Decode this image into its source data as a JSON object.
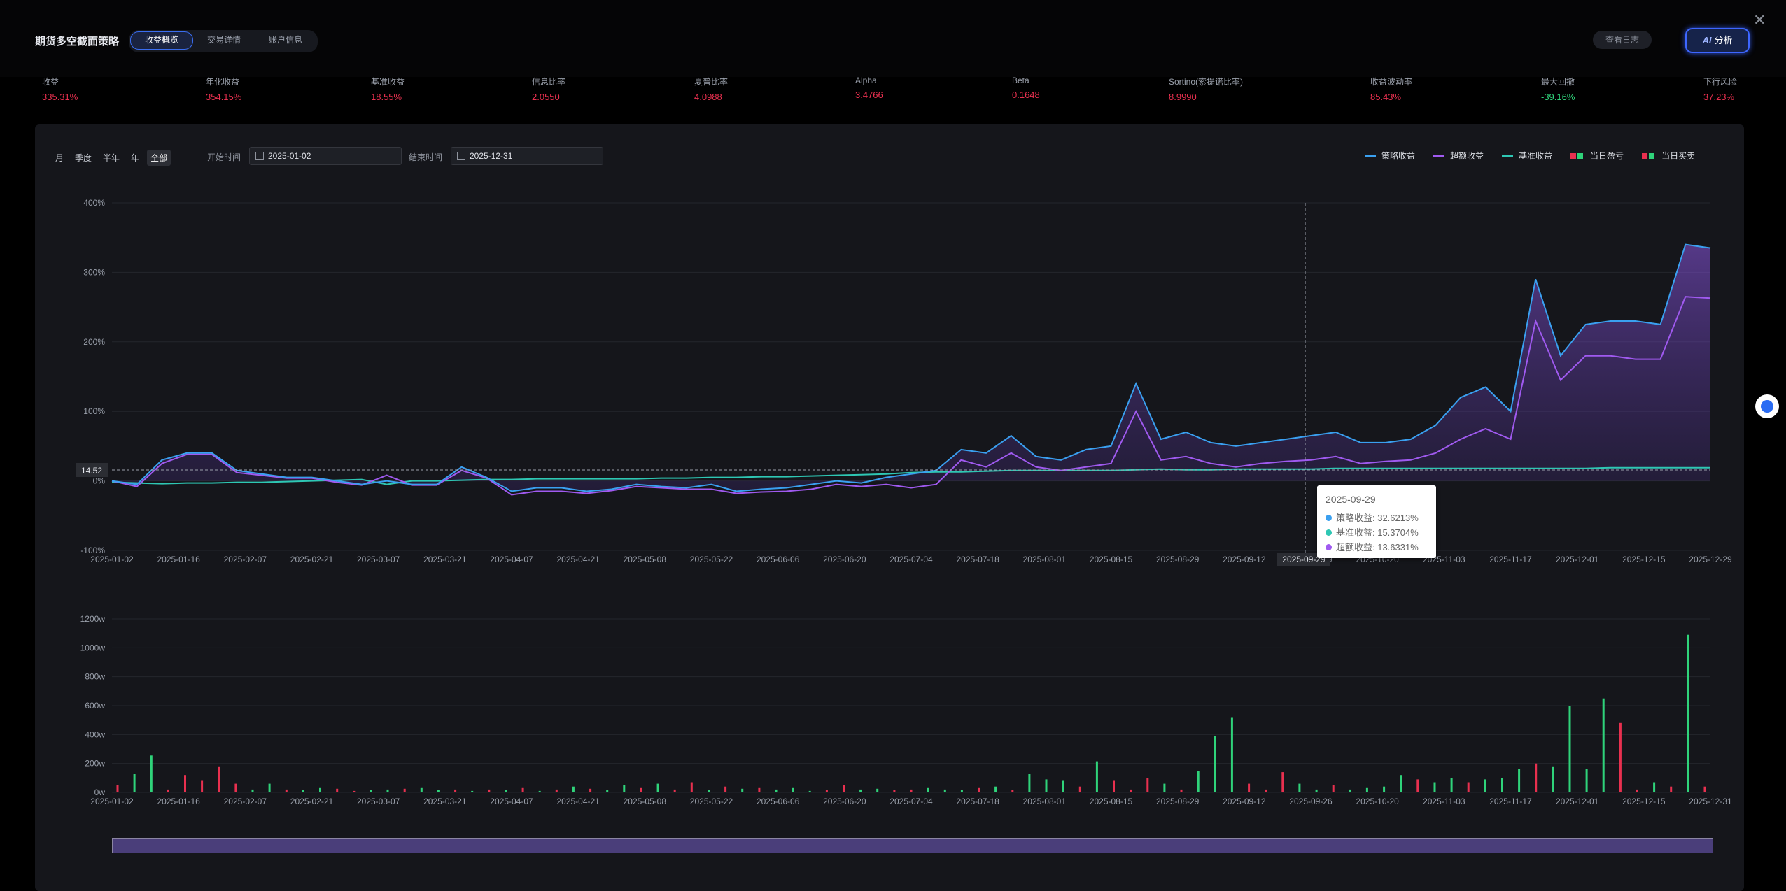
{
  "header": {
    "title": "期货多空截面策略",
    "tabs": [
      "收益概览",
      "交易详情",
      "账户信息"
    ],
    "log_button": "查看日志",
    "ai_prefix": "AI",
    "ai_label": "分析",
    "close": "✕"
  },
  "metrics": [
    {
      "label": "收益",
      "value": "335.31%",
      "tone": "red"
    },
    {
      "label": "年化收益",
      "value": "354.15%",
      "tone": "red"
    },
    {
      "label": "基准收益",
      "value": "18.55%",
      "tone": "red"
    },
    {
      "label": "信息比率",
      "value": "2.0550",
      "tone": "red"
    },
    {
      "label": "夏普比率",
      "value": "4.0988",
      "tone": "red"
    },
    {
      "label": "Alpha",
      "value": "3.4766",
      "tone": "red"
    },
    {
      "label": "Beta",
      "value": "0.1648",
      "tone": "red"
    },
    {
      "label": "Sortino(索提诺比率)",
      "value": "8.9990",
      "tone": "red"
    },
    {
      "label": "收益波动率",
      "value": "85.43%",
      "tone": "red"
    },
    {
      "label": "最大回撤",
      "value": "-39.16%",
      "tone": "green"
    },
    {
      "label": "下行风险",
      "value": "37.23%",
      "tone": "red"
    }
  ],
  "filters": {
    "periods": [
      "月",
      "季度",
      "半年",
      "年",
      "全部"
    ],
    "active_period": "全部",
    "start_label": "开始时间",
    "start_value": "2025-01-02",
    "end_label": "结束时间",
    "end_value": "2025-12-31"
  },
  "legend": {
    "strategy": "策略收益",
    "excess": "超额收益",
    "benchmark": "基准收益",
    "daily_pnl": "当日盈亏",
    "daily_trade": "当日买卖"
  },
  "colors": {
    "strategy": "#3aa0f0",
    "excess": "#a05af0",
    "benchmark": "#2ec7b4",
    "positive": "#e8304f",
    "negative": "#2fd37a"
  },
  "tooltip": {
    "date": "2025-09-29",
    "rows": [
      {
        "label": "策略收益: 32.6213%",
        "color": "#3aa0f0"
      },
      {
        "label": "基准收益: 15.3704%",
        "color": "#2ec7b4"
      },
      {
        "label": "超额收益: 13.6331%",
        "color": "#a05af0"
      }
    ]
  },
  "cursor": {
    "y_label": "14.52",
    "x_label": "2025-09-29"
  },
  "chart_data": [
    {
      "type": "line",
      "x_ticks": [
        "2025-01-02",
        "2025-01-16",
        "2025-02-07",
        "2025-02-21",
        "2025-03-07",
        "2025-03-21",
        "2025-04-07",
        "2025-04-21",
        "2025-05-08",
        "2025-05-22",
        "2025-06-06",
        "2025-06-20",
        "2025-07-04",
        "2025-07-18",
        "2025-08-01",
        "2025-08-15",
        "2025-08-29",
        "2025-09-12",
        "2025-09-29",
        "2025-10-20",
        "2025-11-03",
        "2025-11-17",
        "2025-12-01",
        "2025-12-15",
        "2025-12-29"
      ],
      "y_ticks": [
        "-100%",
        "0%",
        "100%",
        "200%",
        "300%",
        "400%"
      ],
      "ylim": [
        -100,
        400
      ],
      "series": [
        {
          "name": "策略收益",
          "values": [
            0,
            -5,
            30,
            40,
            40,
            15,
            10,
            5,
            5,
            0,
            -5,
            0,
            -5,
            -5,
            20,
            5,
            -15,
            -10,
            -10,
            -15,
            -12,
            -5,
            -8,
            -10,
            -5,
            -15,
            -12,
            -10,
            -5,
            0,
            -3,
            5,
            10,
            15,
            45,
            40,
            65,
            35,
            30,
            45,
            50,
            140,
            60,
            70,
            55,
            50,
            55,
            60,
            65,
            70,
            55,
            55,
            60,
            80,
            120,
            135,
            100,
            290,
            180,
            225,
            230,
            230,
            225,
            340,
            335
          ]
        },
        {
          "name": "超额收益",
          "values": [
            0,
            -8,
            25,
            38,
            38,
            12,
            8,
            4,
            4,
            -2,
            -6,
            8,
            -6,
            -6,
            15,
            4,
            -20,
            -15,
            -15,
            -18,
            -14,
            -8,
            -10,
            -12,
            -12,
            -18,
            -16,
            -15,
            -12,
            -5,
            -8,
            -5,
            -10,
            -5,
            30,
            20,
            40,
            20,
            15,
            20,
            25,
            100,
            30,
            35,
            25,
            20,
            25,
            28,
            30,
            35,
            25,
            28,
            30,
            40,
            60,
            75,
            60,
            230,
            145,
            180,
            180,
            175,
            175,
            265,
            263
          ]
        },
        {
          "name": "基准收益",
          "values": [
            -2,
            -3,
            -4,
            -3,
            -3,
            -2,
            -2,
            -1,
            0,
            1,
            2,
            -5,
            0,
            0,
            1,
            2,
            2,
            3,
            3,
            3,
            3,
            3,
            4,
            4,
            5,
            5,
            6,
            6,
            7,
            8,
            9,
            10,
            12,
            13,
            13,
            14,
            15,
            15,
            15,
            15,
            15,
            16,
            17,
            16,
            16,
            17,
            17,
            17,
            17,
            18,
            18,
            18,
            18,
            18,
            18,
            18,
            18,
            18,
            18,
            18,
            19,
            19,
            19,
            19,
            19
          ]
        }
      ]
    },
    {
      "type": "bar",
      "x_ticks": [
        "2025-01-02",
        "2025-01-16",
        "2025-02-07",
        "2025-02-21",
        "2025-03-07",
        "2025-03-21",
        "2025-04-07",
        "2025-04-21",
        "2025-05-08",
        "2025-05-22",
        "2025-06-06",
        "2025-06-20",
        "2025-07-04",
        "2025-07-18",
        "2025-08-01",
        "2025-08-15",
        "2025-08-29",
        "2025-09-12",
        "2025-09-26",
        "2025-10-20",
        "2025-11-03",
        "2025-11-17",
        "2025-12-01",
        "2025-12-15",
        "2025-12-31"
      ],
      "y_ticks": [
        "0w",
        "200w",
        "400w",
        "600w",
        "800w",
        "1000w",
        "1200w"
      ],
      "ylim": [
        0,
        1200
      ],
      "values": [
        50,
        130,
        255,
        20,
        120,
        80,
        180,
        60,
        20,
        60,
        20,
        15,
        30,
        25,
        10,
        15,
        20,
        25,
        30,
        15,
        20,
        10,
        20,
        15,
        30,
        10,
        20,
        40,
        25,
        15,
        50,
        30,
        60,
        20,
        70,
        15,
        40,
        25,
        30,
        20,
        30,
        10,
        15,
        50,
        20,
        25,
        15,
        20,
        30,
        20,
        15,
        30,
        40,
        15,
        130,
        90,
        80,
        40,
        215,
        80,
        20,
        100,
        60,
        20,
        150,
        390,
        520,
        60,
        20,
        140,
        60,
        20,
        50,
        20,
        30,
        40,
        120,
        90,
        70,
        100,
        70,
        90,
        100,
        160,
        200,
        180,
        600,
        160,
        650,
        480,
        20,
        70,
        40,
        1090,
        40
      ],
      "signs": [
        1,
        0,
        0,
        1,
        1,
        1,
        1,
        1,
        0,
        0,
        1,
        0,
        0,
        1,
        1,
        0,
        0,
        1,
        0,
        0,
        1,
        0,
        1,
        0,
        1,
        0,
        1,
        0,
        1,
        0,
        0,
        1,
        0,
        1,
        1,
        0,
        1,
        0,
        1,
        0,
        0,
        0,
        1,
        1,
        0,
        0,
        1,
        1,
        0,
        0,
        0,
        1,
        0,
        1,
        0,
        0,
        0,
        1,
        0,
        1,
        1,
        1,
        0,
        1,
        0,
        0,
        0,
        1,
        1,
        1,
        0,
        0,
        1,
        0,
        0,
        0,
        0,
        1,
        0,
        0,
        1,
        0,
        0,
        0,
        1,
        0,
        0,
        0,
        0,
        1,
        1,
        0,
        1,
        0,
        1
      ]
    }
  ]
}
